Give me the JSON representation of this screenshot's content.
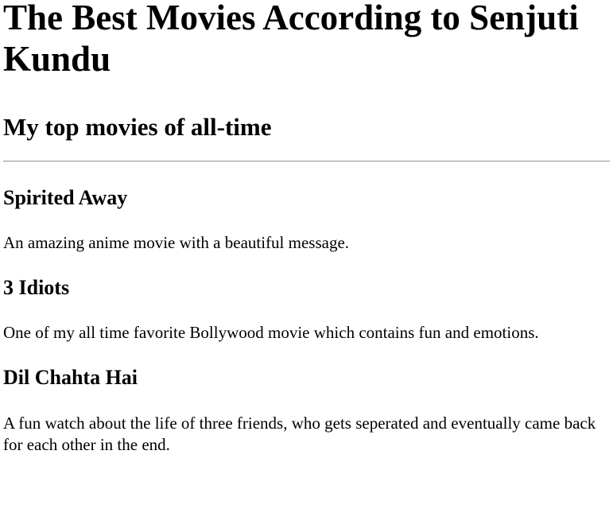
{
  "header": {
    "title": "The Best Movies According to Senjuti Kundu",
    "subtitle": "My top movies of all-time"
  },
  "movies": [
    {
      "title": "Spirited Away",
      "description": "An amazing anime movie with a beautiful message."
    },
    {
      "title": "3 Idiots",
      "description": "One of my all time favorite Bollywood movie which contains fun and emotions."
    },
    {
      "title": "Dil Chahta Hai",
      "description": "A fun watch about the life of three friends, who gets seperated and eventually came back for each other in the end."
    }
  ]
}
